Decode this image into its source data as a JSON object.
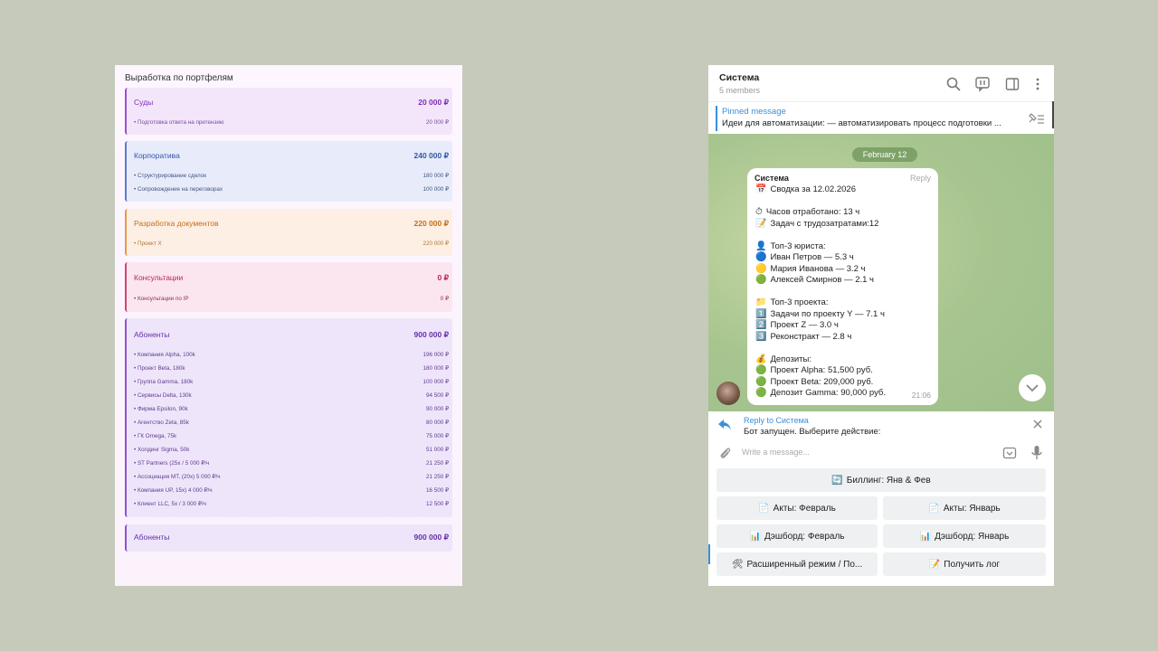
{
  "left_panel": {
    "title": "Выработка по портфелям",
    "cards": [
      {
        "name": "Суды",
        "amount": "20 000 ₽",
        "rows": [
          {
            "label": "Подготовка ответа на претензию",
            "value": "20 000 ₽"
          }
        ]
      },
      {
        "name": "Корпоратива",
        "amount": "240 000 ₽",
        "rows": [
          {
            "label": "Структурирование сделок",
            "value": "180 000 ₽"
          },
          {
            "label": "Сопровождение на переговорах",
            "value": "100 000 ₽"
          }
        ]
      },
      {
        "name": "Разработка документов",
        "amount": "220 000 ₽",
        "rows": [
          {
            "label": "Проект X",
            "value": "220 000 ₽"
          }
        ]
      },
      {
        "name": "Консультации",
        "amount": "0 ₽",
        "rows": [
          {
            "label": "Консультации по IP",
            "value": "0 ₽"
          }
        ]
      },
      {
        "name": "Абоненты",
        "amount": "900 000 ₽",
        "rows": [
          {
            "label": "Компания Alpha, 100k",
            "value": "196 000 ₽"
          },
          {
            "label": "Проект Beta, 180k",
            "value": "180 000 ₽"
          },
          {
            "label": "Группа Gamma, 180k",
            "value": "100 000 ₽"
          },
          {
            "label": "Сервисы Delta, 130k",
            "value": "94 500 ₽"
          },
          {
            "label": "Фирма Epsilon, 90k",
            "value": "90 000 ₽"
          },
          {
            "label": "Агентство Zeta, 85k",
            "value": "80 000 ₽"
          },
          {
            "label": "ГК Omega, 75k",
            "value": "75 000 ₽"
          },
          {
            "label": "Холдинг Sigma, 50k",
            "value": "51 000 ₽"
          },
          {
            "label": "ST Partners (25x / 5 000 ₽/ч",
            "value": "21 250 ₽"
          },
          {
            "label": "Ассоциация МТ, (20x) 5 000 ₽/ч",
            "value": "21 250 ₽"
          },
          {
            "label": "Компания UP, 15x) 4 000 ₽/ч",
            "value": "16 500 ₽"
          },
          {
            "label": "Клиент LLC, 5x / 3 000 ₽/ч",
            "value": "12 500 ₽"
          }
        ]
      },
      {
        "name": "Абоненты",
        "amount": "900 000 ₽",
        "rows": []
      }
    ]
  },
  "chat": {
    "header": {
      "name": "Система",
      "members": "5 members"
    },
    "pinned": {
      "label": "Pinned message",
      "text": "Идеи для автоматизации: — автоматизировать процесс подготовки ..."
    },
    "date_pill": "February 12",
    "message": {
      "sender": "Система",
      "reply_label": "Reply",
      "time": "21:06",
      "lines": [
        {
          "icon": "📅",
          "text": "Сводка за 12.02.2026"
        },
        {
          "icon": "",
          "text": ""
        },
        {
          "icon": "⏱",
          "text": "Часов отработано: 13 ч"
        },
        {
          "icon": "📝",
          "text": "Задач с трудозатратами:12"
        },
        {
          "icon": "",
          "text": ""
        },
        {
          "icon": "👤",
          "text": "Топ-3 юриста:"
        },
        {
          "icon": "🔵",
          "text": "Иван Петров — 5.3 ч"
        },
        {
          "icon": "🟡",
          "text": "Мария Иванова — 3.2 ч"
        },
        {
          "icon": "🟢",
          "text": "Алексей Смирнов — 2.1 ч"
        },
        {
          "icon": "",
          "text": ""
        },
        {
          "icon": "📁",
          "text": "Топ-3 проекта:"
        },
        {
          "icon": "1️⃣",
          "text": "Задачи по проекту Y — 7.1 ч"
        },
        {
          "icon": "2️⃣",
          "text": "Проект Z — 3.0 ч"
        },
        {
          "icon": "3️⃣",
          "text": "Реконстракт — 2.8 ч"
        },
        {
          "icon": "",
          "text": ""
        },
        {
          "icon": "💰",
          "text": "Депозиты:"
        },
        {
          "icon": "🟢",
          "text": "Проект Alpha: 51,500 руб."
        },
        {
          "icon": "🟢",
          "text": "Проект Beta: 209,000 руб."
        },
        {
          "icon": "🟢",
          "text": "Депозит Gamma: 90,000 руб."
        }
      ]
    },
    "reply_bar": {
      "label": "Reply to Система",
      "text": "Бот запущен. Выберите действие:"
    },
    "input": {
      "placeholder": "Write a message..."
    },
    "keyboard": [
      {
        "icon": "🔄",
        "label": "Биллинг: Янв & Фев"
      },
      {
        "icon": "📄",
        "label": "Акты: Февраль"
      },
      {
        "icon": "📄",
        "label": "Акты: Январь"
      },
      {
        "icon": "📊",
        "label": "Дэшборд: Февраль"
      },
      {
        "icon": "📊",
        "label": "Дэшборд: Январь"
      },
      {
        "icon": "🛠",
        "label": "Расширенный режим / По..."
      },
      {
        "icon": "📝",
        "label": "Получить лог"
      }
    ],
    "icons": {
      "search": "search-icon",
      "thread": "comments-icon",
      "sidebar": "sidebar-icon",
      "more": "more-vertical-icon",
      "pin": "pin-list-icon",
      "reply": "reply-arrow-icon",
      "close": "close-icon",
      "attach": "paperclip-icon",
      "commands": "bot-commands-icon",
      "mic": "microphone-icon",
      "scroll": "chevron-down-icon"
    },
    "colors": {
      "accent": "#3a8fd8",
      "chat_bg": "#a8c590"
    }
  }
}
